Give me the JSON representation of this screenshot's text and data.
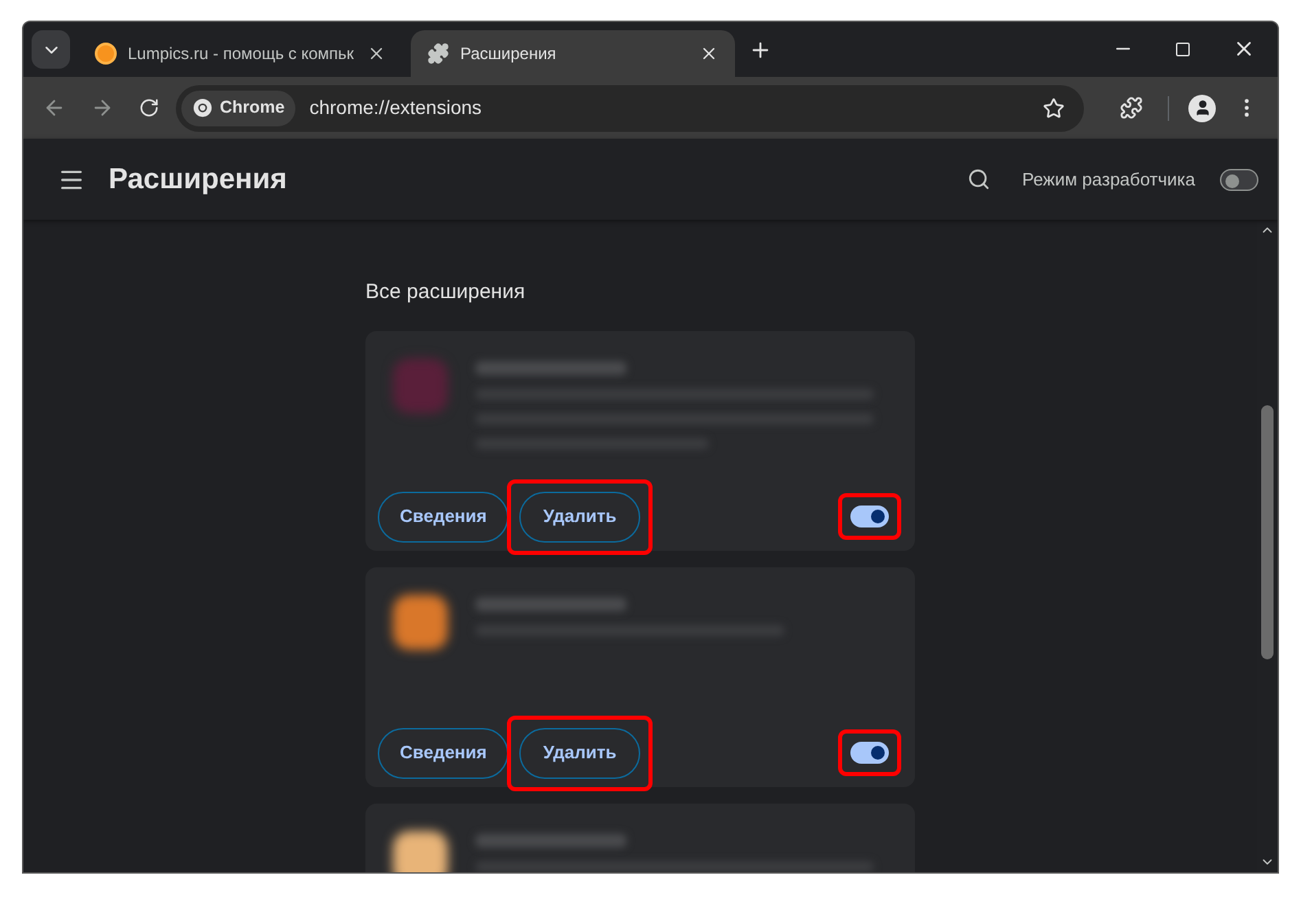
{
  "tabs": [
    {
      "title": "Lumpics.ru - помощь с компьк",
      "selected": false
    },
    {
      "title": "Расширения",
      "selected": true
    }
  ],
  "address_bar": {
    "chip": "Chrome",
    "url": "chrome://extensions"
  },
  "header": {
    "title": "Расширения",
    "dev_mode": {
      "label": "Режим разработчика",
      "on": false
    }
  },
  "section_title": "Все расширения",
  "cards": [
    {
      "color": "#5a1f3a",
      "details": "Сведения",
      "remove": "Удалить",
      "on": true,
      "highlighted": true
    },
    {
      "color": "#d9772a",
      "details": "Сведения",
      "remove": "Удалить",
      "on": true,
      "highlighted": true
    },
    {
      "color": "#e8b478"
    }
  ]
}
